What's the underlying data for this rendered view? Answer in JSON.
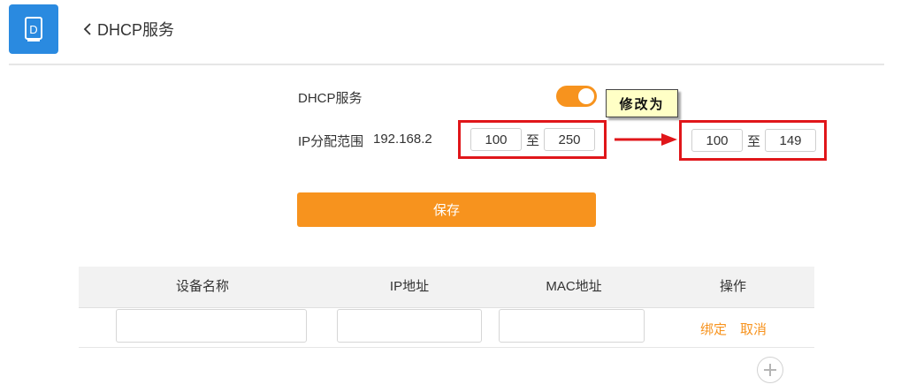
{
  "header": {
    "app_icon": "doc-d-icon",
    "back_icon": "chevron-left-icon",
    "title": "DHCP服务",
    "accent_color": "#2a8ae0"
  },
  "dhcp": {
    "service_label": "DHCP服务",
    "service_enabled": true,
    "range_label": "IP分配范围",
    "ip_prefix": "192.168.2",
    "range_start": "100",
    "range_end": "250",
    "to_label": "至"
  },
  "annotation": {
    "callout_text": "修改为",
    "new_range_start": "100",
    "new_range_end": "149",
    "to_label": "至",
    "frame_color": "#e0161a"
  },
  "save_button": {
    "label": "保存",
    "color": "#f7931e"
  },
  "binding_table": {
    "columns": [
      "设备名称",
      "IP地址",
      "MAC地址",
      "操作"
    ],
    "row": {
      "device_name": "",
      "ip": "",
      "mac": "",
      "bind_label": "绑定",
      "cancel_label": "取消"
    },
    "add_icon": "plus-circle-icon"
  }
}
